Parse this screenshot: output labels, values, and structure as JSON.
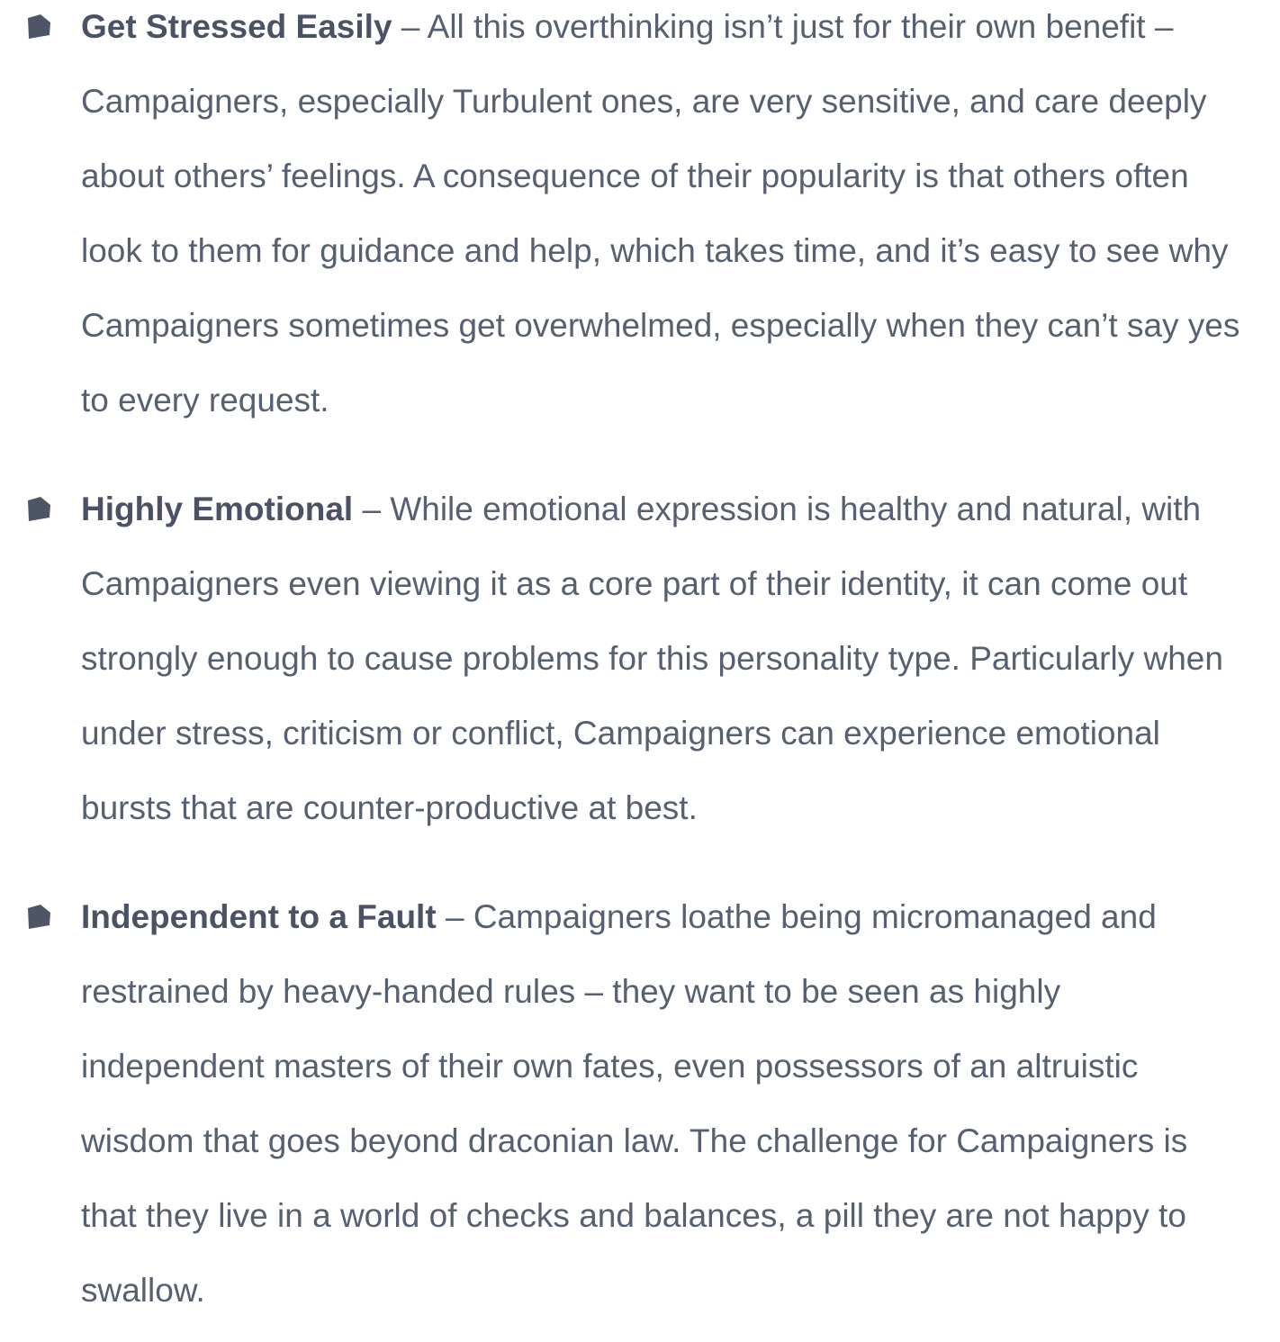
{
  "items": [
    {
      "bullet_icon": "pentagon-bullet",
      "term": "Get Stressed Easily",
      "separator": " – ",
      "text": "All this overthinking isn’t just for their own benefit – Campaigners, especially Turbulent ones, are very sensitive, and care deeply about others’ feelings. A consequence of their popularity is that others often look to them for guidance and help, which takes time, and it’s easy to see why Campaigners sometimes get overwhelmed, especially when they can’t say yes to every request."
    },
    {
      "bullet_icon": "pentagon-bullet",
      "term": "Highly Emotional",
      "separator": " – ",
      "text": "While emotional expression is healthy and natural, with Campaigners even viewing it as a core part of their identity, it can come out strongly enough to cause problems for this personality type. Particularly when under stress, criticism or conflict, Campaigners can experience emotional bursts that are counter-productive at best."
    },
    {
      "bullet_icon": "pentagon-bullet",
      "term": "Independent to a Fault",
      "separator": " – ",
      "text": "Campaigners loathe being micromanaged and restrained by heavy-handed rules – they want to be seen as highly independent masters of their own fates, even possessors of an altruistic wisdom that goes beyond draconian law. The challenge for Campaigners is that they live in a world of checks and balances, a pill they are not happy to swallow."
    }
  ],
  "colors": {
    "text": "#576071",
    "term": "#4a5264",
    "bullet": "#4d5566"
  }
}
